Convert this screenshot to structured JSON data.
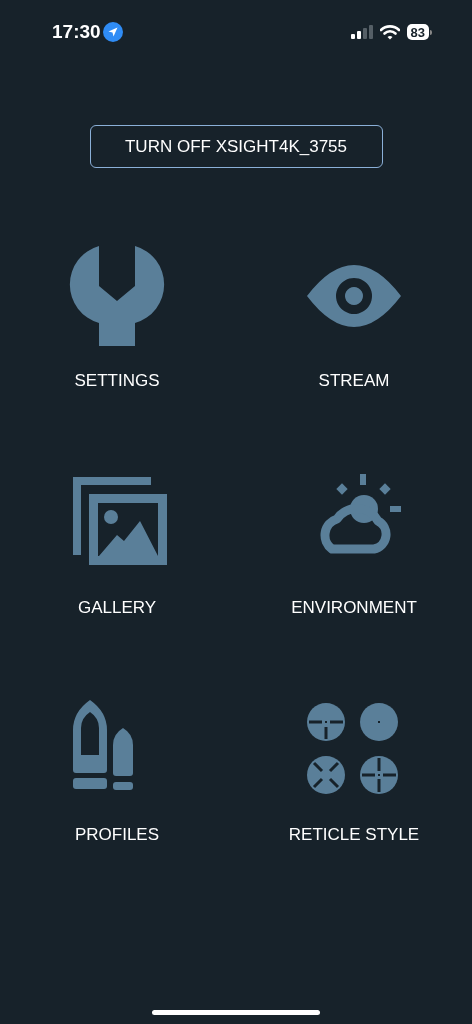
{
  "status_bar": {
    "time": "17:30",
    "battery": "83"
  },
  "turn_off_button": {
    "label": "TURN OFF XSIGHT4K_3755"
  },
  "tiles": [
    {
      "kind": "wrench",
      "label": "SETTINGS"
    },
    {
      "kind": "eye",
      "label": "STREAM"
    },
    {
      "kind": "gallery",
      "label": "GALLERY"
    },
    {
      "kind": "weather",
      "label": "ENVIRONMENT"
    },
    {
      "kind": "bullets",
      "label": "PROFILES"
    },
    {
      "kind": "reticles",
      "label": "RETICLE STYLE"
    }
  ]
}
